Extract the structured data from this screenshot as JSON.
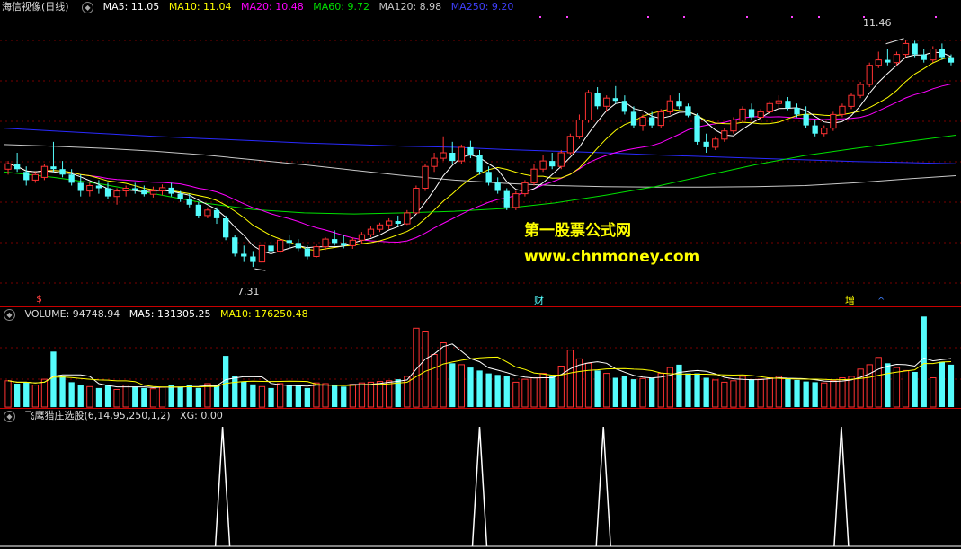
{
  "colors": {
    "bg": "#000000",
    "grid": "#7a0000",
    "up": "#ff3232",
    "down": "#54fcfc",
    "ma5": "#ffffff",
    "ma10": "#ffff00",
    "ma20": "#ff00ff",
    "ma60": "#00e000",
    "ma120": "#c8c8c8",
    "ma250": "#2a2aff",
    "separator": "#c80000",
    "watermark": "#ffff00"
  },
  "main_legend": {
    "title": "海信视像(日线)",
    "ma5": "MA5: 11.05",
    "ma10": "MA10: 11.04",
    "ma20": "MA20: 10.48",
    "ma60": "MA60: 9.72",
    "ma120": "MA120: 8.98",
    "ma250": "MA250: 9.20"
  },
  "high_label": "11.46",
  "low_label": "7.31",
  "markers": {
    "left": "$",
    "mid": "财",
    "right": "增",
    "right_arrow": "^"
  },
  "volume_legend": {
    "volume": "VOLUME: 94748.94",
    "ma5": "MA5: 131305.25",
    "ma10": "MA10: 176250.48"
  },
  "indicator_legend": {
    "name": "飞鹰猎庄选股(6,14,95,250,1,2)",
    "xg": "XG: 0.00"
  },
  "watermark": {
    "line1": "第一股票公式网",
    "line2": "www.chnmoney.com"
  },
  "chart_data": {
    "type": "candlestick",
    "price_range": [
      6.9,
      11.9
    ],
    "candles": [
      [
        9.1,
        9.25,
        9.0,
        9.2
      ],
      [
        9.2,
        9.4,
        9.05,
        9.1
      ],
      [
        9.05,
        9.15,
        8.8,
        8.9
      ],
      [
        8.9,
        9.05,
        8.85,
        9.0
      ],
      [
        8.95,
        9.2,
        8.9,
        9.15
      ],
      [
        9.15,
        9.6,
        9.05,
        9.1
      ],
      [
        9.1,
        9.25,
        8.95,
        9.0
      ],
      [
        9.0,
        9.1,
        8.8,
        8.85
      ],
      [
        8.85,
        9.0,
        8.6,
        8.7
      ],
      [
        8.7,
        8.85,
        8.6,
        8.8
      ],
      [
        8.8,
        8.9,
        8.65,
        8.75
      ],
      [
        8.75,
        8.85,
        8.55,
        8.6
      ],
      [
        8.6,
        8.75,
        8.45,
        8.7
      ],
      [
        8.7,
        8.8,
        8.6,
        8.75
      ],
      [
        8.75,
        8.85,
        8.65,
        8.72
      ],
      [
        8.72,
        8.8,
        8.6,
        8.64
      ],
      [
        8.64,
        8.78,
        8.58,
        8.7
      ],
      [
        8.7,
        8.82,
        8.62,
        8.76
      ],
      [
        8.76,
        8.85,
        8.6,
        8.65
      ],
      [
        8.65,
        8.7,
        8.5,
        8.55
      ],
      [
        8.55,
        8.65,
        8.4,
        8.45
      ],
      [
        8.45,
        8.5,
        8.2,
        8.25
      ],
      [
        8.25,
        8.4,
        8.2,
        8.35
      ],
      [
        8.35,
        8.4,
        8.1,
        8.2
      ],
      [
        8.2,
        8.25,
        7.8,
        7.85
      ],
      [
        7.85,
        7.9,
        7.5,
        7.55
      ],
      [
        7.55,
        7.7,
        7.4,
        7.5
      ],
      [
        7.5,
        7.6,
        7.31,
        7.4
      ],
      [
        7.4,
        7.75,
        7.38,
        7.7
      ],
      [
        7.7,
        7.8,
        7.55,
        7.6
      ],
      [
        7.6,
        7.85,
        7.55,
        7.8
      ],
      [
        7.8,
        7.9,
        7.65,
        7.75
      ],
      [
        7.75,
        7.82,
        7.6,
        7.65
      ],
      [
        7.65,
        7.7,
        7.45,
        7.5
      ],
      [
        7.5,
        7.72,
        7.48,
        7.68
      ],
      [
        7.68,
        7.85,
        7.62,
        7.82
      ],
      [
        7.82,
        7.98,
        7.7,
        7.75
      ],
      [
        7.75,
        7.9,
        7.65,
        7.7
      ],
      [
        7.7,
        7.85,
        7.64,
        7.8
      ],
      [
        7.8,
        7.95,
        7.74,
        7.9
      ],
      [
        7.9,
        8.05,
        7.85,
        8.0
      ],
      [
        8.0,
        8.12,
        7.95,
        8.08
      ],
      [
        8.08,
        8.2,
        8.0,
        8.15
      ],
      [
        8.15,
        8.25,
        8.05,
        8.1
      ],
      [
        8.1,
        8.35,
        8.08,
        8.3
      ],
      [
        8.3,
        8.8,
        8.28,
        8.75
      ],
      [
        8.75,
        9.2,
        8.7,
        9.15
      ],
      [
        9.15,
        9.4,
        9.05,
        9.3
      ],
      [
        9.3,
        9.7,
        9.25,
        9.4
      ],
      [
        9.4,
        9.6,
        9.2,
        9.25
      ],
      [
        9.25,
        9.55,
        9.2,
        9.5
      ],
      [
        9.5,
        9.62,
        9.3,
        9.35
      ],
      [
        9.35,
        9.45,
        9.0,
        9.05
      ],
      [
        9.05,
        9.15,
        8.8,
        8.85
      ],
      [
        8.85,
        8.95,
        8.65,
        8.7
      ],
      [
        8.7,
        8.75,
        8.35,
        8.4
      ],
      [
        8.4,
        8.7,
        8.35,
        8.65
      ],
      [
        8.65,
        8.9,
        8.6,
        8.85
      ],
      [
        8.85,
        9.2,
        8.8,
        9.1
      ],
      [
        9.1,
        9.35,
        9.05,
        9.25
      ],
      [
        9.25,
        9.4,
        9.1,
        9.15
      ],
      [
        9.15,
        9.45,
        9.1,
        9.4
      ],
      [
        9.4,
        9.75,
        9.35,
        9.7
      ],
      [
        9.7,
        10.1,
        9.65,
        10.0
      ],
      [
        10.0,
        10.55,
        9.95,
        10.5
      ],
      [
        10.5,
        10.6,
        10.2,
        10.25
      ],
      [
        10.25,
        10.45,
        10.15,
        10.4
      ],
      [
        10.4,
        10.62,
        10.3,
        10.35
      ],
      [
        10.35,
        10.45,
        10.1,
        10.15
      ],
      [
        10.15,
        10.25,
        9.85,
        9.9
      ],
      [
        9.9,
        10.1,
        9.8,
        10.05
      ],
      [
        10.05,
        10.15,
        9.85,
        9.9
      ],
      [
        9.9,
        10.2,
        9.85,
        10.15
      ],
      [
        10.15,
        10.45,
        10.1,
        10.35
      ],
      [
        10.35,
        10.5,
        10.2,
        10.25
      ],
      [
        10.25,
        10.3,
        10.05,
        10.08
      ],
      [
        10.08,
        10.12,
        9.55,
        9.6
      ],
      [
        9.6,
        9.75,
        9.4,
        9.5
      ],
      [
        9.5,
        9.7,
        9.45,
        9.65
      ],
      [
        9.65,
        9.85,
        9.6,
        9.8
      ],
      [
        9.8,
        10.05,
        9.75,
        10.0
      ],
      [
        10.0,
        10.25,
        9.95,
        10.2
      ],
      [
        10.2,
        10.3,
        10.0,
        10.05
      ],
      [
        10.05,
        10.2,
        10.0,
        10.15
      ],
      [
        10.15,
        10.35,
        10.1,
        10.3
      ],
      [
        10.3,
        10.45,
        10.2,
        10.35
      ],
      [
        10.35,
        10.42,
        10.18,
        10.22
      ],
      [
        10.22,
        10.3,
        10.05,
        10.1
      ],
      [
        10.1,
        10.25,
        9.85,
        9.9
      ],
      [
        9.9,
        10.0,
        9.7,
        9.75
      ],
      [
        9.75,
        9.9,
        9.7,
        9.85
      ],
      [
        9.85,
        10.15,
        9.8,
        10.1
      ],
      [
        10.1,
        10.3,
        10.05,
        10.25
      ],
      [
        10.25,
        10.5,
        10.2,
        10.45
      ],
      [
        10.45,
        10.7,
        10.4,
        10.65
      ],
      [
        10.65,
        11.05,
        10.6,
        11.0
      ],
      [
        11.0,
        11.25,
        10.95,
        11.1
      ],
      [
        11.1,
        11.3,
        11.0,
        11.05
      ],
      [
        11.05,
        11.25,
        11.0,
        11.2
      ],
      [
        11.2,
        11.46,
        11.15,
        11.4
      ],
      [
        11.4,
        11.45,
        11.15,
        11.2
      ],
      [
        11.2,
        11.3,
        11.05,
        11.1
      ],
      [
        11.1,
        11.35,
        11.05,
        11.3
      ],
      [
        11.3,
        11.4,
        11.1,
        11.15
      ],
      [
        11.15,
        11.2,
        11.0,
        11.05
      ]
    ],
    "ma_series": {
      "ma250": [
        9.85,
        9.8,
        9.75,
        9.7,
        9.66,
        9.62,
        9.58,
        9.55,
        9.52,
        9.5,
        9.46,
        9.43,
        9.4,
        9.36,
        9.33,
        9.3,
        9.27,
        9.24,
        9.22,
        9.2
      ],
      "ma120": [
        9.55,
        9.52,
        9.48,
        9.43,
        9.36,
        9.27,
        9.18,
        9.08,
        8.98,
        8.9,
        8.84,
        8.8,
        8.78,
        8.77,
        8.77,
        8.78,
        8.8,
        8.85,
        8.92,
        8.98
      ],
      "ma60": [
        9.05,
        8.95,
        8.82,
        8.65,
        8.48,
        8.36,
        8.3,
        8.28,
        8.3,
        8.33,
        8.38,
        8.48,
        8.62,
        8.78,
        8.98,
        9.18,
        9.35,
        9.48,
        9.6,
        9.72
      ]
    },
    "volume_range": [
      0,
      560000
    ],
    "volume": [
      180,
      160,
      170,
      150,
      190,
      380,
      210,
      170,
      150,
      140,
      130,
      150,
      120,
      150,
      140,
      130,
      125,
      135,
      150,
      140,
      150,
      130,
      160,
      145,
      350,
      210,
      175,
      155,
      140,
      130,
      160,
      150,
      145,
      130,
      165,
      160,
      150,
      140,
      155,
      165,
      170,
      175,
      180,
      190,
      210,
      540,
      520,
      360,
      440,
      300,
      290,
      270,
      250,
      230,
      220,
      210,
      170,
      190,
      200,
      230,
      210,
      280,
      390,
      330,
      300,
      250,
      230,
      200,
      210,
      190,
      195,
      200,
      230,
      270,
      290,
      230,
      230,
      200,
      185,
      170,
      180,
      210,
      190,
      190,
      200,
      210,
      195,
      185,
      175,
      170,
      165,
      180,
      200,
      210,
      260,
      290,
      340,
      300,
      270,
      250,
      240,
      620,
      200,
      310,
      290,
      260,
      200,
      220,
      190,
      160
    ],
    "signals": [
      46,
      100,
      126,
      176
    ]
  }
}
